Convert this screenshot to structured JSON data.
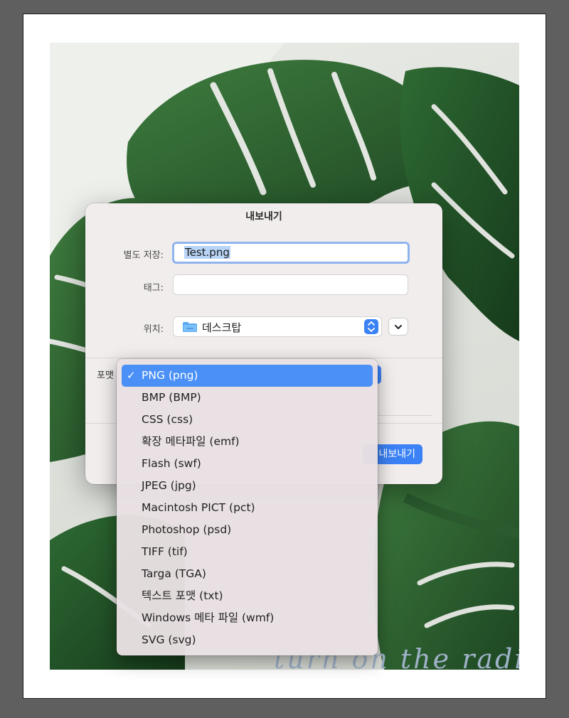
{
  "watermark": {
    "text": "turn on the radio"
  },
  "dialog": {
    "title": "내보내기",
    "save_as": {
      "label": "별도 저장:",
      "value": "Test.png"
    },
    "tags": {
      "label": "태그:",
      "value": ""
    },
    "location": {
      "label": "위치:",
      "value": "데스크탑"
    },
    "format": {
      "label": "포맷"
    },
    "export_button": {
      "label": "내보내기"
    }
  },
  "format_menu": {
    "items": [
      {
        "label": "PNG (png)",
        "selected": true
      },
      {
        "label": "BMP (BMP)"
      },
      {
        "label": "CSS (css)"
      },
      {
        "label": "확장 메타파일 (emf)"
      },
      {
        "label": "Flash (swf)"
      },
      {
        "label": "JPEG (jpg)"
      },
      {
        "label": "Macintosh PICT (pct)"
      },
      {
        "label": "Photoshop (psd)"
      },
      {
        "label": "TIFF (tif)"
      },
      {
        "label": "Targa (TGA)"
      },
      {
        "label": "텍스트 포맷 (txt)"
      },
      {
        "label": "Windows 메타 파일 (wmf)"
      },
      {
        "label": "SVG (svg)"
      }
    ],
    "check_glyph": "✓"
  },
  "colors": {
    "accent": "#3b82f6",
    "menu_highlight": "#4a90f7",
    "leaf_dark": "#1f4a24",
    "leaf_mid": "#2f6b33"
  }
}
